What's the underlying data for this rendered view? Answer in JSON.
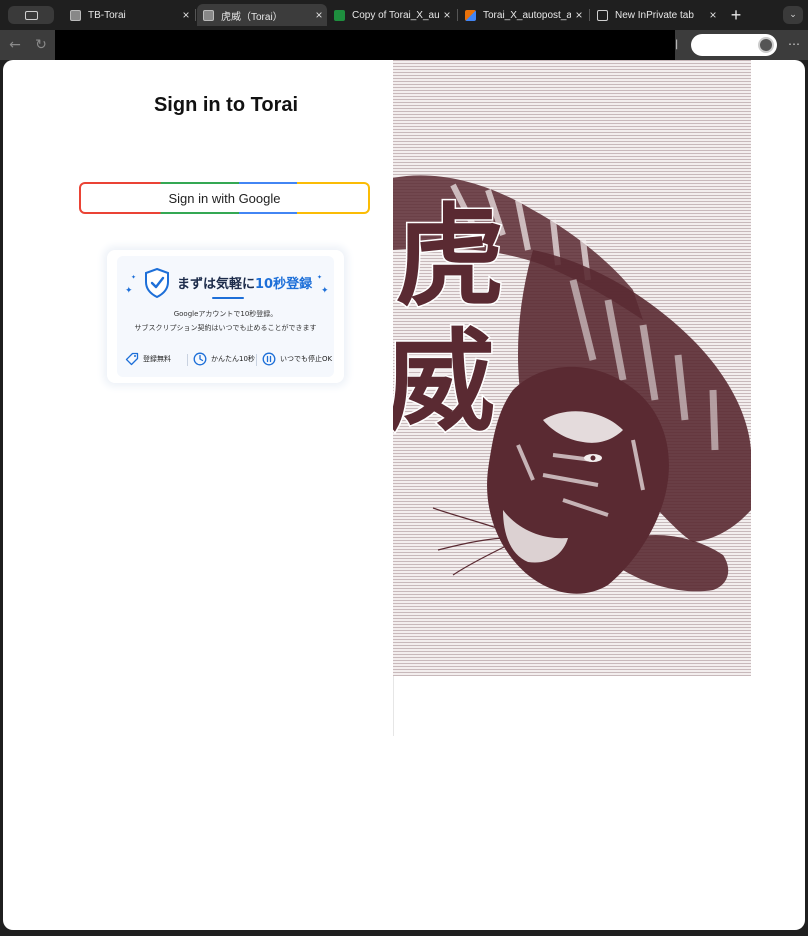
{
  "browser": {
    "tabs": [
      {
        "title": "TB-Torai",
        "favicon": "torai-favicon",
        "active": false
      },
      {
        "title": "虎威（Torai）",
        "favicon": "torai-favicon",
        "active": true
      },
      {
        "title": "Copy of Torai_X_autopost",
        "favicon": "sheets-favicon",
        "active": false
      },
      {
        "title": "Torai_X_autopost_app",
        "favicon": "script-favicon",
        "active": false
      },
      {
        "title": "New InPrivate tab",
        "favicon": "inprivate-favicon",
        "active": false
      }
    ],
    "close_glyph": "×",
    "new_tab_glyph": "+",
    "menu_glyph": "⌄",
    "back_glyph": "←",
    "reload_glyph": "↻",
    "more_glyph": "⋯"
  },
  "signin": {
    "title": "Sign in to Torai",
    "google_button_label": "Sign in with Google"
  },
  "promo": {
    "headline_prefix": "まずは気軽に",
    "headline_accent": "10秒登録",
    "line1": "Googleアカウントで10秒登録。",
    "line2": "サブスクリプション契約はいつでも止めることができます",
    "features": [
      {
        "icon": "tag-icon",
        "label": "登録無料"
      },
      {
        "icon": "clock-icon",
        "label": "かんたん10秒"
      },
      {
        "icon": "pause-icon",
        "label": "いつでも停止OK"
      }
    ],
    "accent_color": "#1d6fd8"
  },
  "artwork": {
    "calligraphy": [
      "虎",
      "威"
    ],
    "ink_color": "#5a2a32"
  }
}
